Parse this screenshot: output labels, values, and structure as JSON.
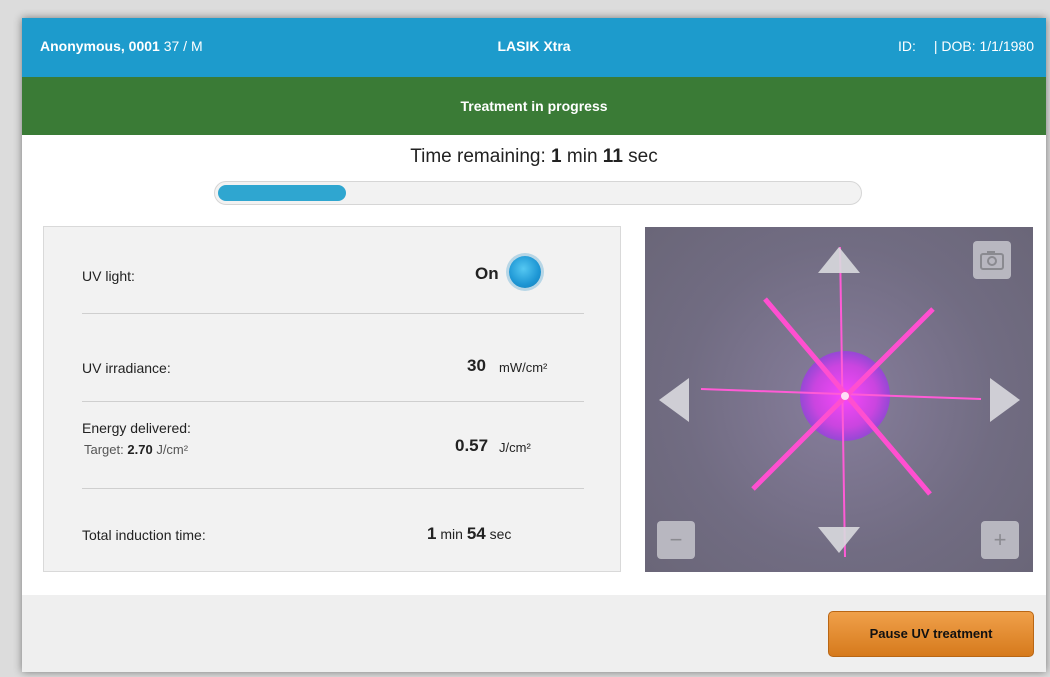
{
  "header": {
    "patient_name": "Anonymous, 0001",
    "patient_info": "37 / M",
    "title": "LASIK Xtra",
    "id_label": "ID:",
    "dob": "| DOB: 1/1/1980"
  },
  "status": {
    "message": "Treatment in progress",
    "color": "#3a7b36"
  },
  "timer": {
    "prefix": "Time remaining:",
    "minutes": "1",
    "min_unit": "min",
    "seconds": "11",
    "sec_unit": "sec",
    "progress": 0.2
  },
  "metrics": {
    "uv_light": {
      "label": "UV light:",
      "value": "On",
      "indicator_color": "#1d96d4"
    },
    "uv_irradiance": {
      "label": "UV irradiance:",
      "value": "30",
      "unit": "mW/cm²"
    },
    "energy": {
      "label": "Energy delivered:",
      "target_prefix": "Target:",
      "target_value": "2.70",
      "target_unit": "J/cm²",
      "value": "0.57",
      "unit": "J/cm²"
    },
    "induction": {
      "label": "Total induction time:",
      "minutes": "1",
      "min_unit": "min",
      "seconds": "54",
      "sec_unit": "sec"
    }
  },
  "camera": {
    "icons": [
      "camera-icon",
      "arrow-up-icon",
      "arrow-down-icon",
      "arrow-left-icon",
      "arrow-right-icon"
    ],
    "zoom_out_label": "−",
    "zoom_in_label": "+"
  },
  "actions": {
    "pause_label": "Pause UV treatment",
    "accent": "#e08a2c"
  },
  "colors": {
    "header": "#1d9bcc",
    "progress": "#2fa6d0"
  }
}
